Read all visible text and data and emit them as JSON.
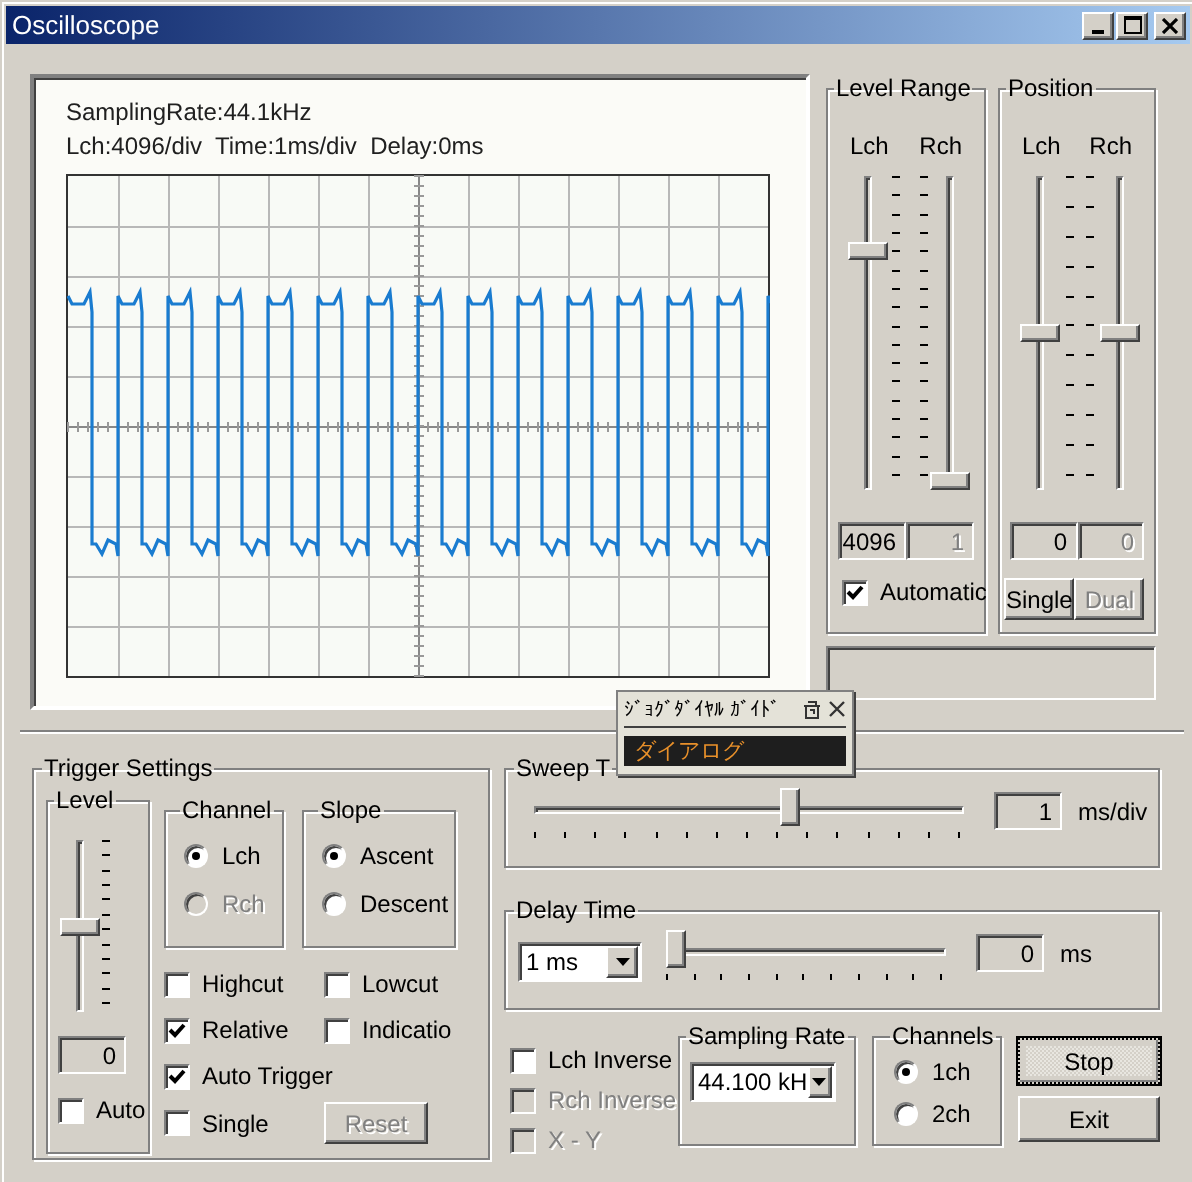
{
  "window": {
    "title": "Oscilloscope"
  },
  "scope": {
    "info_lines": [
      "SamplingRate:44.1kHz",
      "Lch:4096/div  Time:1ms/div  Delay:0ms"
    ]
  },
  "level_range": {
    "title": "Level Range",
    "channels": [
      {
        "label": "Lch",
        "level": 0.78,
        "value": "4096",
        "disabled": false
      },
      {
        "label": "Rch",
        "level": 0,
        "value": "1",
        "disabled": true
      }
    ],
    "automatic": {
      "label": "Automatic",
      "checked": true
    }
  },
  "position": {
    "title": "Position",
    "channels": [
      {
        "label": "Lch",
        "level": 0.5,
        "value": "0",
        "disabled": false
      },
      {
        "label": "Rch",
        "level": 0.5,
        "value": "0",
        "disabled": true
      }
    ],
    "buttons": [
      {
        "label": "Single",
        "disabled": false
      },
      {
        "label": "Dual",
        "disabled": true
      }
    ]
  },
  "trigger": {
    "title": "Trigger Settings",
    "level": {
      "title": "Level",
      "level": 0.5,
      "value": "0",
      "auto": {
        "label": "Auto",
        "checked": false
      }
    },
    "channel": {
      "title": "Channel",
      "options": [
        {
          "label": "Lch",
          "selected": true,
          "disabled": false
        },
        {
          "label": "Rch",
          "selected": false,
          "disabled": true
        }
      ]
    },
    "slope": {
      "title": "Slope",
      "options": [
        {
          "label": "Ascent",
          "selected": true,
          "disabled": false
        },
        {
          "label": "Descent",
          "selected": false,
          "disabled": false
        }
      ]
    },
    "checkboxes": [
      {
        "label": "Highcut",
        "checked": false
      },
      {
        "label": "Lowcut",
        "checked": false
      },
      {
        "label": "Relative",
        "checked": true
      },
      {
        "label": "Indicatio",
        "checked": false
      },
      {
        "label": "Auto Trigger",
        "checked": true
      },
      {
        "label": "Single",
        "checked": false
      }
    ],
    "reset": {
      "label": "Reset",
      "disabled": true
    }
  },
  "sweep_time": {
    "title": "Sweep T",
    "level": 0.6,
    "value": "1",
    "unit": "ms/div"
  },
  "delay_time": {
    "title": "Delay Time",
    "range": "1 ms",
    "level": 0,
    "value": "0",
    "unit": "ms"
  },
  "options": [
    {
      "label": "Lch Inverse",
      "checked": false,
      "disabled": false
    },
    {
      "label": "Rch Inverse",
      "checked": false,
      "disabled": true
    },
    {
      "label": "X - Y",
      "checked": false,
      "disabled": true
    }
  ],
  "sampling_rate": {
    "title": "Sampling Rate",
    "value": "44.100 kH"
  },
  "channels": {
    "title": "Channels",
    "options": [
      {
        "label": "1ch",
        "selected": true
      },
      {
        "label": "2ch",
        "selected": false
      }
    ]
  },
  "buttons": [
    {
      "label": "Stop",
      "focused": true
    },
    {
      "label": "Exit",
      "focused": false
    }
  ],
  "guide_popup": {
    "title": "ｼﾞｮｸﾞﾀﾞｲﾔﾙ ｶﾞｲﾄﾞ",
    "items": [
      {
        "label": "ダイアログ",
        "selected": true
      }
    ]
  }
}
